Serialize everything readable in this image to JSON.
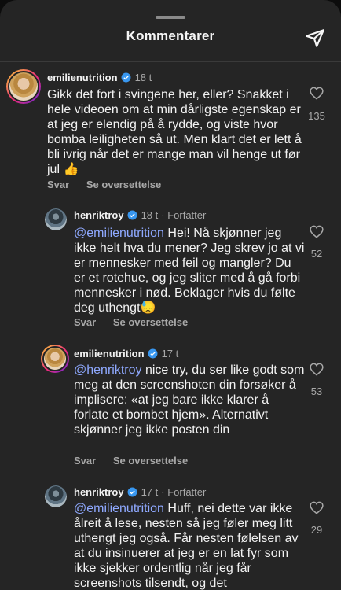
{
  "header": {
    "title": "Kommentarer",
    "share_icon": "paper-plane-icon"
  },
  "comments": [
    {
      "username": "emilienutrition",
      "time": "18 t",
      "author_tag": "",
      "text_before": "Gikk det fort i svingene her, eller? Snakket i hele videoen om at min dårligste egenskap er at jeg er elendig på å rydde, og viste hvor bomba leiligheten så ut. Men klart det er lett å bli ivrig når det er mange man vil henge ut før jul 👍",
      "mention": "",
      "likes": "135",
      "reply_label": "Svar",
      "translate_label": "Se oversettelse"
    },
    {
      "username": "henriktroy",
      "time": "18 t",
      "author_tag": "· Forfatter",
      "mention": "@emilienutrition",
      "text_after": " Hei! Nå skjønner jeg ikke helt hva du mener? Jeg skrev jo at vi er mennesker med feil og mangler? Du er et rotehue, og jeg sliter med å gå forbi mennesker i nød. Beklager hvis du følte deg uthengt😓",
      "likes": "52",
      "reply_label": "Svar",
      "translate_label": "Se oversettelse"
    },
    {
      "username": "emilienutrition",
      "time": "17 t",
      "author_tag": "",
      "mention": "@henriktroy",
      "text_after": " nice try, du ser like godt som meg at den screenshoten din forsøker å implisere: «at jeg bare ikke klarer å forlate et bombet hjem». Alternativt skjønner jeg ikke posten din",
      "likes": "53",
      "reply_label": "Svar",
      "translate_label": "Se oversettelse"
    },
    {
      "username": "henriktroy",
      "time": "17 t",
      "author_tag": "· Forfatter",
      "mention": "@emilienutrition",
      "text_after": " Huff, nei dette var ikke ålreit å lese, nesten så jeg føler meg litt uthengt jeg også. Får nesten følelsen av at du insinuerer at jeg er en lat fyr som ikke sjekker  ordentlig når jeg får screenshots tilsendt, og det",
      "likes": "29"
    }
  ],
  "colors": {
    "background": "#252525",
    "mention": "#8fa9ff",
    "verified": "#3897f0",
    "secondary_text": "#a8a8a8"
  }
}
